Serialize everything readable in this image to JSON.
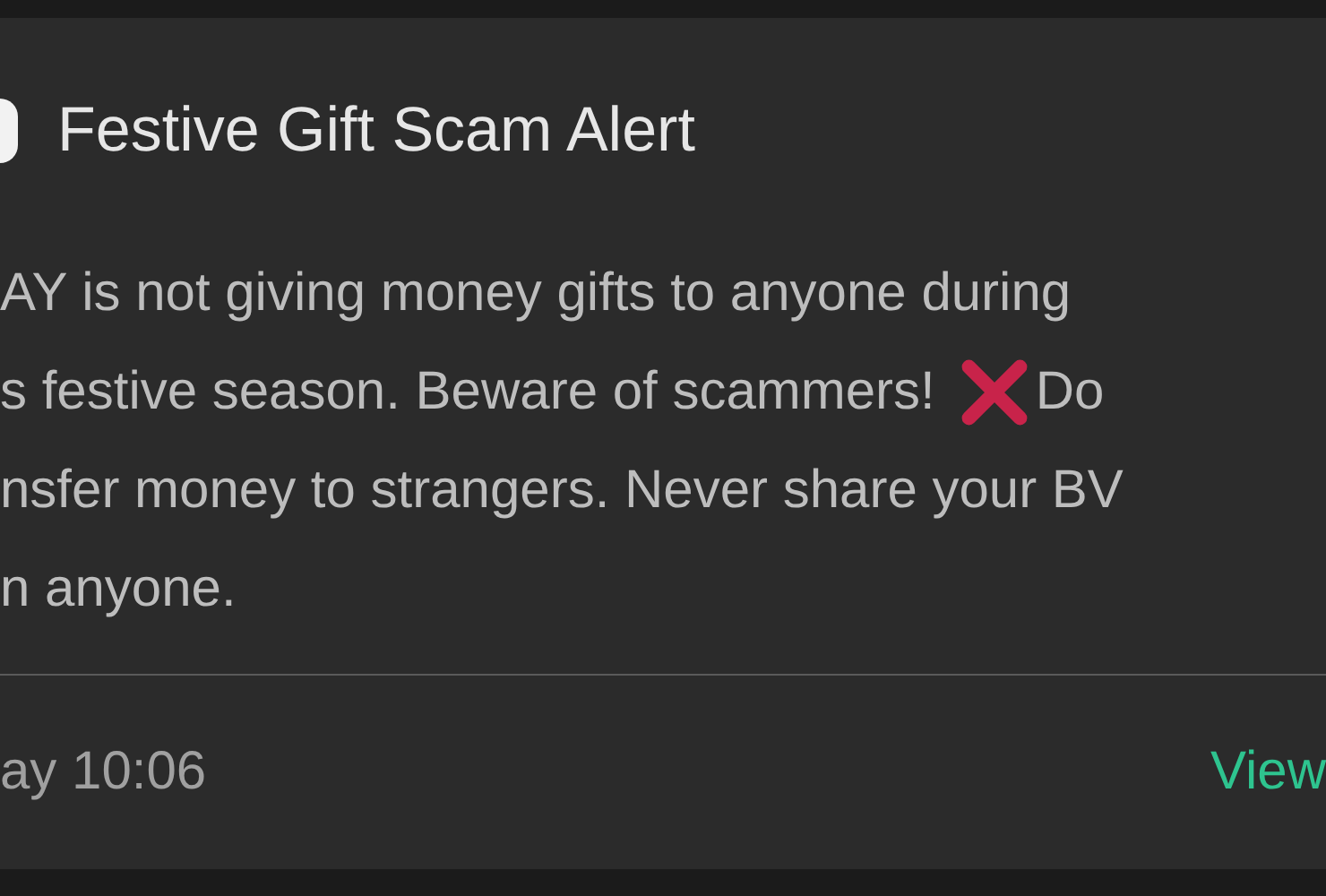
{
  "notification": {
    "title": "Festive Gift Scam Alert",
    "body_lines": [
      {
        "kind": "plain",
        "text": "AY is not giving money gifts to anyone during"
      },
      {
        "kind": "with-icon",
        "text": "s festive season. Beware of scammers!",
        "after": "Do"
      },
      {
        "kind": "plain",
        "text": "nsfer money to strangers. Never share your BV"
      },
      {
        "kind": "plain",
        "text": "n anyone."
      }
    ],
    "time": "ay 10:06",
    "action": "View"
  }
}
